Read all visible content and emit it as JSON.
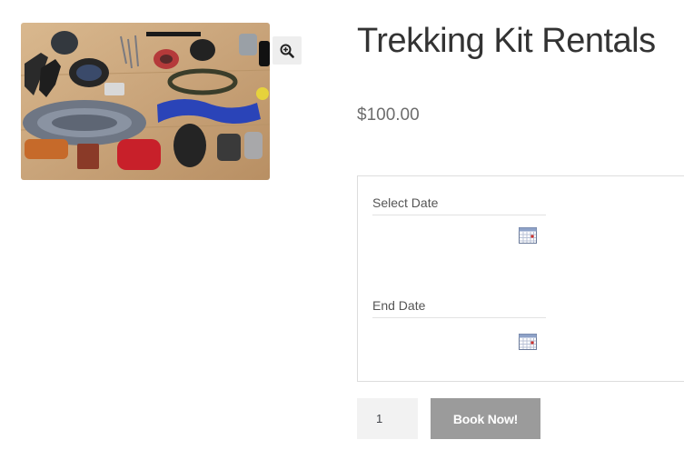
{
  "product": {
    "image_alt": "Trekking gear laid out on a wooden floor",
    "title": "Trekking Kit Rentals",
    "price": "$100.00"
  },
  "booking": {
    "start_label": "Select Date",
    "start_value": "",
    "end_label": "End Date",
    "end_value": ""
  },
  "cart": {
    "quantity": "1",
    "button_label": "Book Now!"
  },
  "colors": {
    "button_bg": "#9b9b9b",
    "quantity_bg": "#f2f2f2",
    "zoom_bg": "#eeeeee"
  },
  "icons": {
    "zoom": "zoom-in-icon",
    "calendar": "calendar-icon"
  }
}
